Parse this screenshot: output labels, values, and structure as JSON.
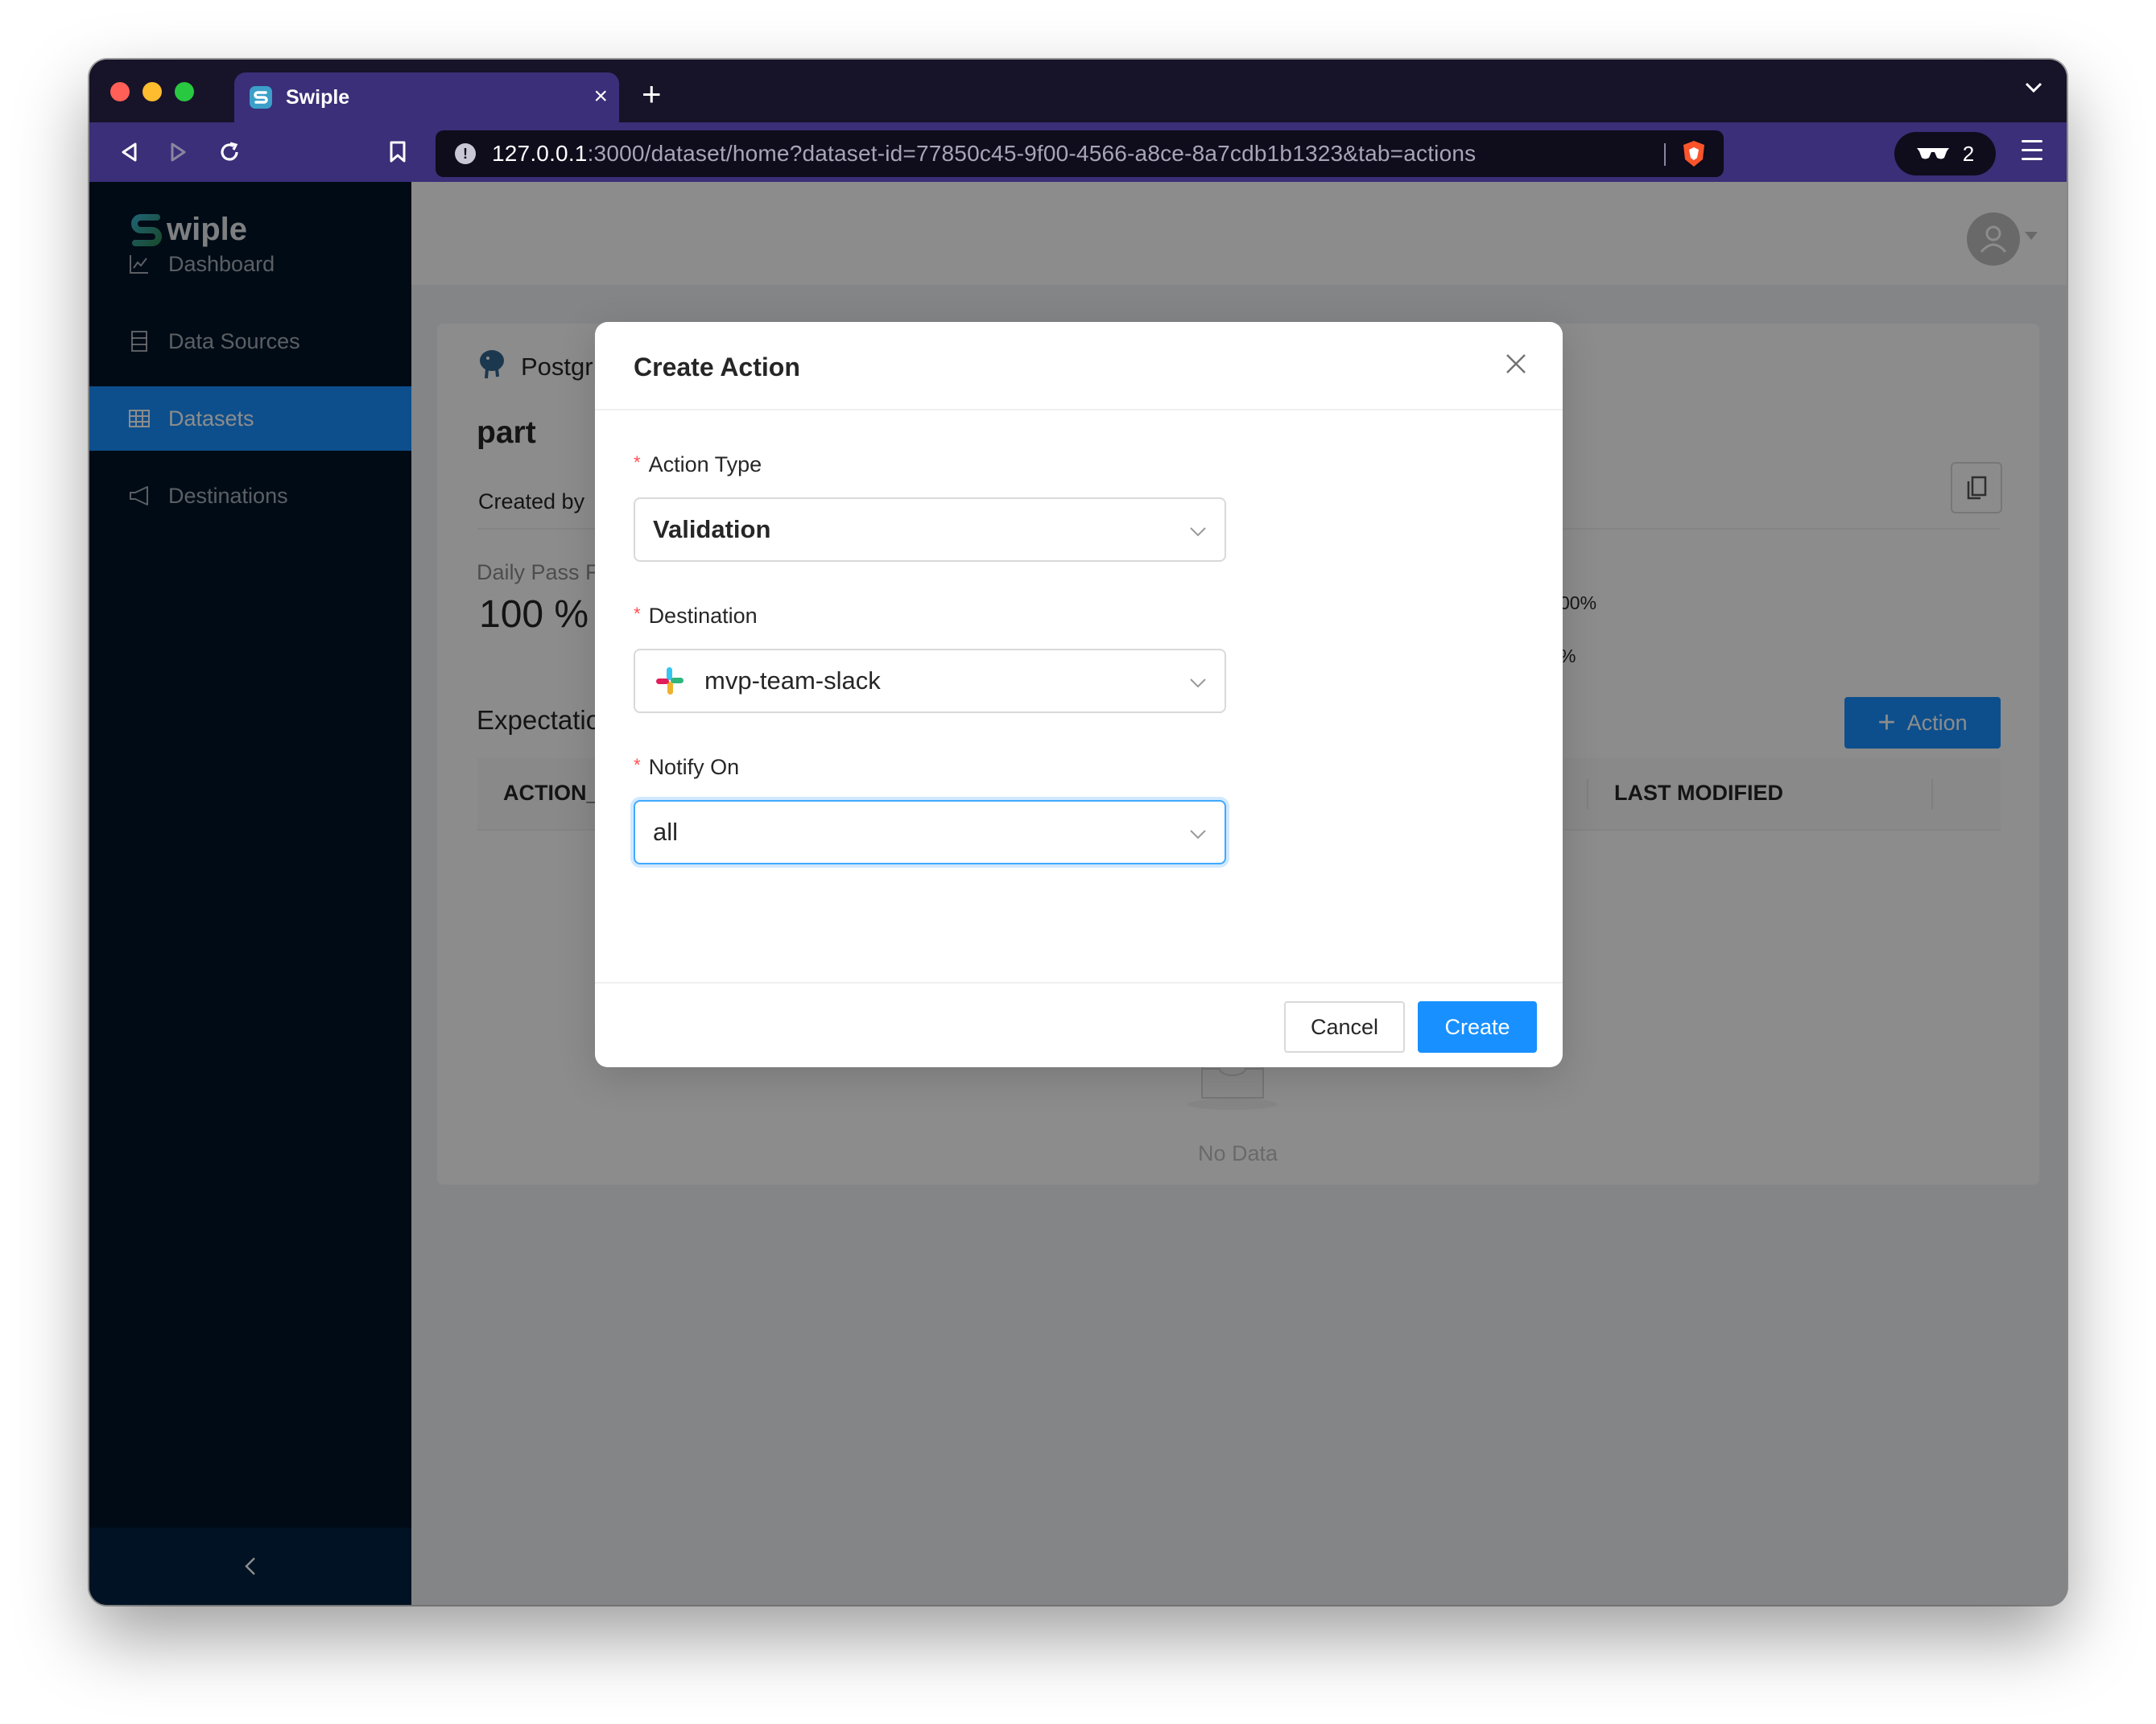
{
  "browser": {
    "tab_title": "Swiple",
    "url_host": "127.0.0.1",
    "url_rest": ":3000/dataset/home?dataset-id=77850c45-9f00-4566-a8ce-8a7cdb1b1323&tab=actions",
    "rewards_count": "2"
  },
  "sidebar": {
    "logo_text": "wiple",
    "items": [
      {
        "label": "Dashboard",
        "icon": "line-chart-icon"
      },
      {
        "label": "Data Sources",
        "icon": "database-icon"
      },
      {
        "label": "Datasets",
        "icon": "table-icon",
        "active": true
      },
      {
        "label": "Destinations",
        "icon": "notification-icon"
      }
    ],
    "collapse_glyph": "<"
  },
  "page": {
    "source_label": "Postgr",
    "dataset_name": "part",
    "created_by": "Created by",
    "daily_pass_label": "Daily Pass F",
    "daily_pass_value": "100 %",
    "stat_right_1": "00%",
    "stat_right_2": "%",
    "section_title": "Expectatio",
    "add_action_label": "Action",
    "table_columns": [
      "ACTION_",
      "LAST MODIFIED"
    ],
    "empty_text": "No Data"
  },
  "modal": {
    "title": "Create Action",
    "fields": [
      {
        "label": "Action Type",
        "value": "Validation"
      },
      {
        "label": "Destination",
        "value": "mvp-team-slack"
      },
      {
        "label": "Notify On",
        "value": "all"
      }
    ],
    "cancel_label": "Cancel",
    "create_label": "Create"
  },
  "colors": {
    "primary": "#1890ff",
    "sidebar_bg": "#001529",
    "browser_chrome": "#3a2f78"
  }
}
